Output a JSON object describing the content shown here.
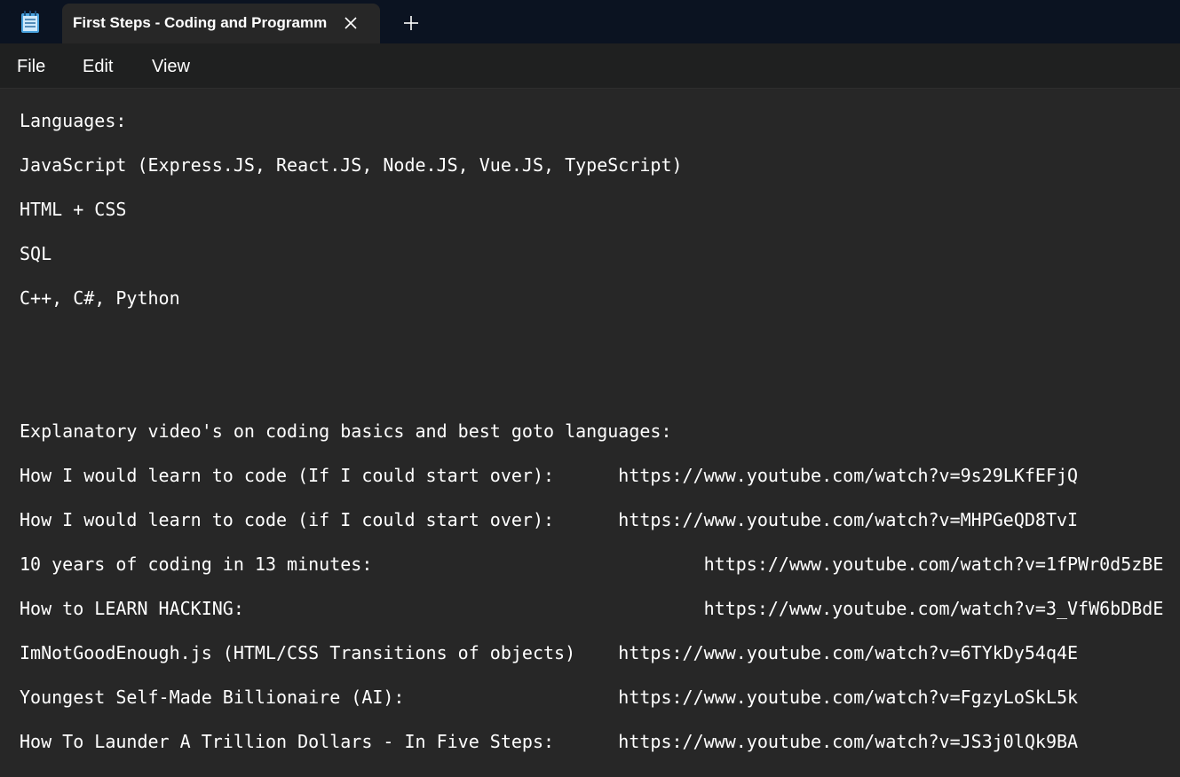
{
  "tab": {
    "title": "First Steps - Coding and Programming"
  },
  "menu": {
    "file": "File",
    "edit": "Edit",
    "view": "View"
  },
  "editor": {
    "lines": [
      "Languages:",
      "JavaScript (Express.JS, React.JS, Node.JS, Vue.JS, TypeScript)",
      "HTML + CSS",
      "SQL",
      "C++, C#, Python",
      "",
      "",
      "Explanatory video's on coding basics and best goto languages:",
      "How I would learn to code (If I could start over):      https://www.youtube.com/watch?v=9s29LKfEFjQ",
      "How I would learn to code (if I could start over):      https://www.youtube.com/watch?v=MHPGeQD8TvI",
      "10 years of coding in 13 minutes:                               https://www.youtube.com/watch?v=1fPWr0d5zBE",
      "How to LEARN HACKING:                                           https://www.youtube.com/watch?v=3_VfW6bDBdE",
      "ImNotGoodEnough.js (HTML/CSS Transitions of objects)    https://www.youtube.com/watch?v=6TYkDy54q4E",
      "Youngest Self-Made Billionaire (AI):                    https://www.youtube.com/watch?v=FgzyLoSkL5k",
      "How To Launder A Trillion Dollars - In Five Steps:      https://www.youtube.com/watch?v=JS3j0lQk9BA"
    ]
  },
  "icons": {
    "app": "notepad-icon",
    "close": "close-icon",
    "add": "plus-icon"
  },
  "colors": {
    "titlebar": "#0b1321",
    "menubar": "#1f2020",
    "editor_bg": "#272727",
    "text": "#ffffff",
    "accent": "#4aa3df"
  }
}
